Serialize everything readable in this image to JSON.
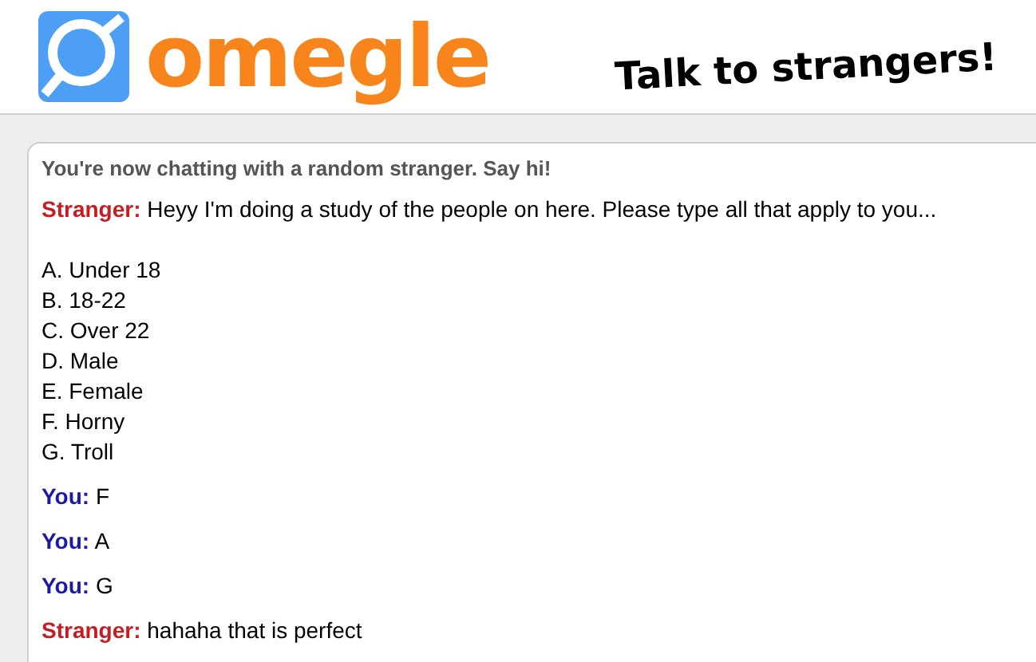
{
  "header": {
    "logo_text": "omegle",
    "tagline": "Talk to strangers!"
  },
  "chat": {
    "status": "You're now chatting with a random stranger. Say hi!",
    "messages": [
      {
        "kind": "stranger",
        "sender": "Stranger:",
        "text": "Heyy I'm doing a study of the people on here. Please type all that apply to you...",
        "list": [
          "A. Under 18",
          "B. 18-22",
          "C. Over 22",
          "D. Male",
          "E. Female",
          "F. Horny",
          "G. Troll"
        ]
      },
      {
        "kind": "you",
        "sender": "You:",
        "text": "F"
      },
      {
        "kind": "you",
        "sender": "You:",
        "text": "A"
      },
      {
        "kind": "you",
        "sender": "You:",
        "text": "G"
      },
      {
        "kind": "stranger",
        "sender": "Stranger:",
        "text": "hahaha that is perfect"
      }
    ]
  }
}
